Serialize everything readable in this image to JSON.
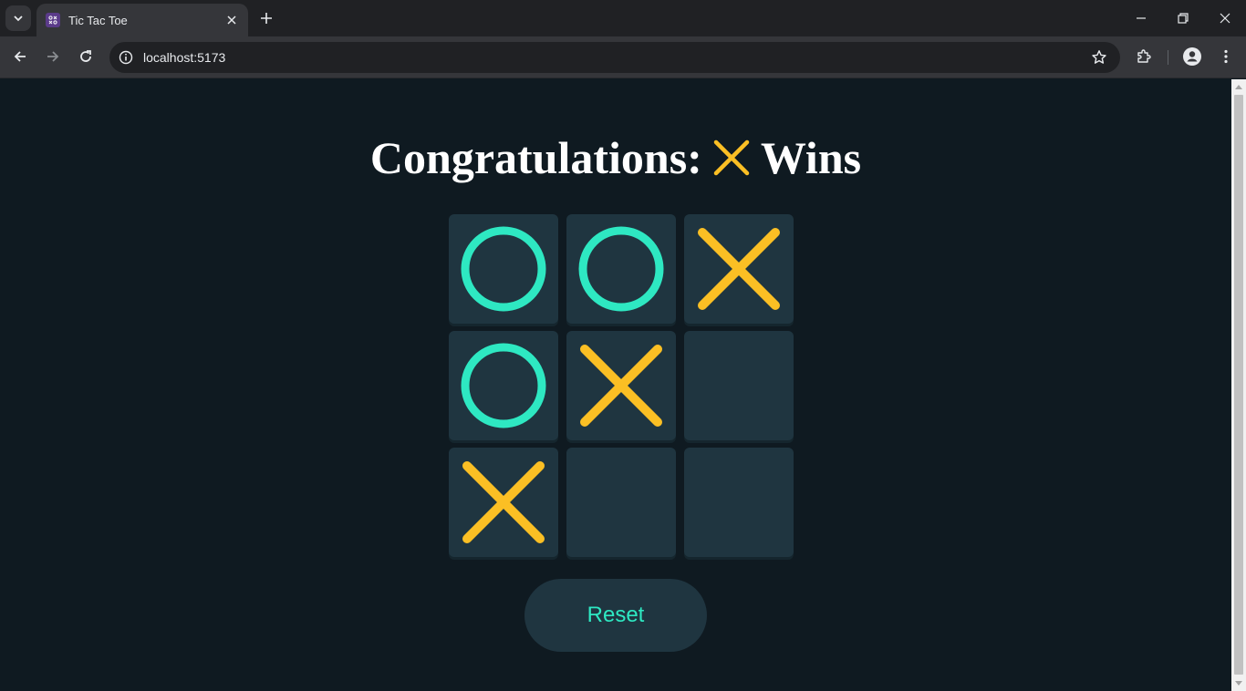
{
  "browser": {
    "tab_title": "Tic Tac Toe",
    "url": "localhost:5173"
  },
  "game": {
    "status_prefix": "Congratulations:",
    "winner_icon": "x-mark-icon",
    "status_suffix": "Wins",
    "board": [
      "O",
      "O",
      "X",
      "O",
      "X",
      "",
      "X",
      "",
      ""
    ],
    "reset_label": "Reset"
  },
  "colors": {
    "x": "#fbbf24",
    "o": "#2ee8c2",
    "cell": "#1f3540",
    "background": "#0f1a21",
    "heading": "#ffffff"
  }
}
